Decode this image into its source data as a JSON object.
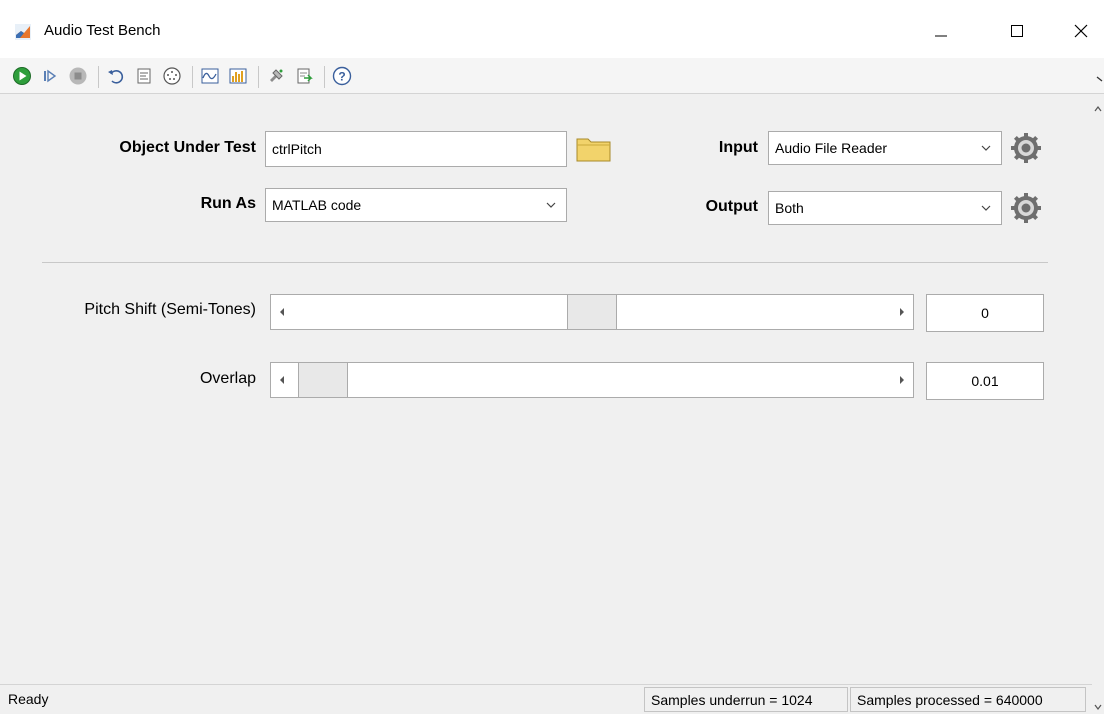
{
  "window": {
    "title": "Audio Test Bench"
  },
  "toolbar": {
    "buttons": [
      {
        "icon": "run-icon"
      },
      {
        "icon": "step-icon"
      },
      {
        "icon": "stop-icon"
      },
      {
        "icon": "undo-icon"
      },
      {
        "icon": "generate-code-icon"
      },
      {
        "icon": "midi-icon"
      },
      {
        "icon": "time-scope-icon"
      },
      {
        "icon": "spectrum-analyzer-icon"
      },
      {
        "icon": "plugin-icon"
      },
      {
        "icon": "export-icon"
      },
      {
        "icon": "help-icon"
      }
    ]
  },
  "form": {
    "object_under_test_label": "Object Under Test",
    "object_under_test_value": "ctrlPitch",
    "run_as_label": "Run As",
    "run_as_value": "MATLAB code",
    "input_label": "Input",
    "input_value": "Audio File Reader",
    "output_label": "Output",
    "output_value": "Both"
  },
  "parameters": [
    {
      "label": "Pitch Shift (Semi-Tones)",
      "value": "0",
      "fraction": 0.5
    },
    {
      "label": "Overlap",
      "value": "0.01",
      "fraction": 0.01
    }
  ],
  "status": {
    "ready": "Ready",
    "underrun": "Samples underrun = 1024",
    "processed": "Samples processed = 640000"
  },
  "colors": {
    "run_green": "#2e9e3b",
    "matlab_orange": "#e8762c",
    "folder_yellow": "#f2d36b"
  }
}
